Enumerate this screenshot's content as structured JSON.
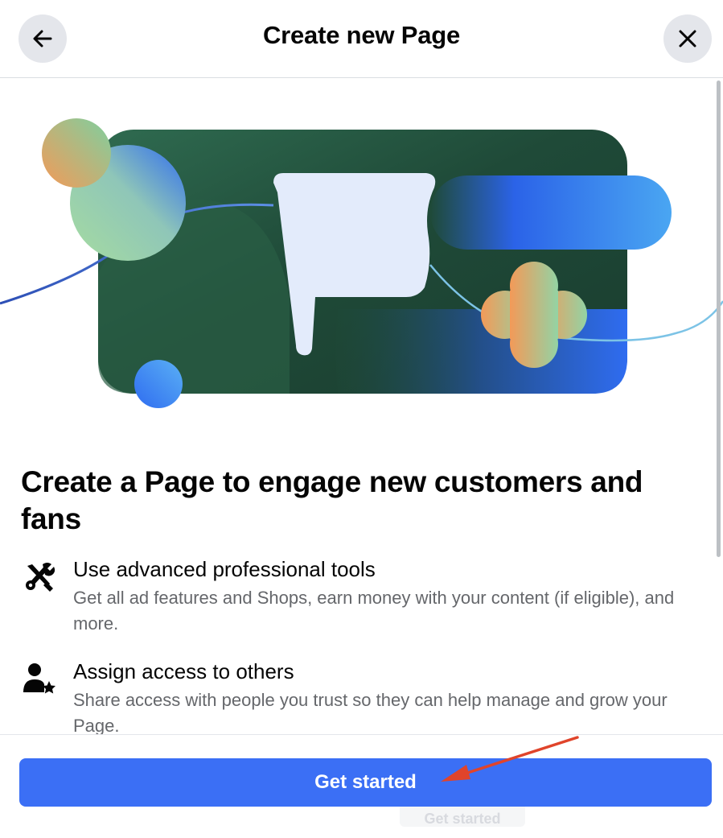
{
  "header": {
    "title": "Create new Page",
    "back_icon": "arrow-left-icon",
    "close_icon": "close-icon"
  },
  "illustration": {
    "icon": "flag-illustration",
    "colors": {
      "card_dark_green": "#1f4a38",
      "card_mid_green": "#2f6b4f",
      "flag": "#e3ebfb",
      "pill_blue": "#2b63e8",
      "accent_blue": "#3d7ef5",
      "accent_orange": "#f39a58",
      "accent_green": "#8ecf9a"
    }
  },
  "main": {
    "headline": "Create a Page to engage new customers and fans",
    "features": [
      {
        "icon": "tools-icon",
        "title": "Use advanced professional tools",
        "description": "Get all ad features and Shops, earn money with your content (if eligible), and more."
      },
      {
        "icon": "person-star-icon",
        "title": "Assign access to others",
        "description": "Share access with people you trust so they can help manage and grow your Page."
      }
    ]
  },
  "footer": {
    "get_started_label": "Get started",
    "ghost_label": "Get started",
    "button_color": "#3b6ff5"
  },
  "annotation": {
    "arrow_color": "#e0442b"
  }
}
